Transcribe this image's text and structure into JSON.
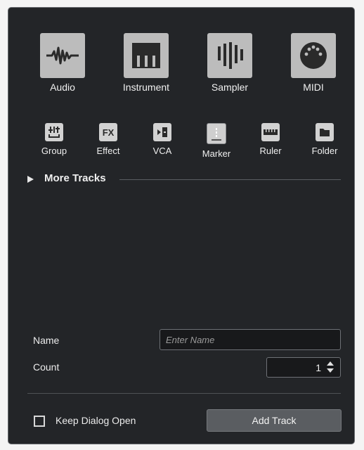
{
  "track_types": [
    {
      "label": "Audio",
      "icon": "audio-waveform-icon"
    },
    {
      "label": "Instrument",
      "icon": "piano-keys-icon"
    },
    {
      "label": "Sampler",
      "icon": "sampler-bars-icon"
    },
    {
      "label": "MIDI",
      "icon": "midi-connector-icon"
    }
  ],
  "small_types": [
    {
      "label": "Group",
      "icon": "group-icon"
    },
    {
      "label": "Effect",
      "icon": "fx-icon",
      "glyph": "FX"
    },
    {
      "label": "VCA",
      "icon": "vca-icon"
    },
    {
      "label": "Marker",
      "icon": "marker-icon"
    },
    {
      "label": "Ruler",
      "icon": "ruler-icon"
    },
    {
      "label": "Folder",
      "icon": "folder-icon"
    }
  ],
  "more_tracks": {
    "label": "More Tracks"
  },
  "form": {
    "name_label": "Name",
    "name_placeholder": "Enter Name",
    "count_label": "Count",
    "count_value": "1"
  },
  "footer": {
    "keep_open_label": "Keep Dialog Open",
    "keep_open_checked": false,
    "add_button_label": "Add Track"
  },
  "colors": {
    "dialog_bg": "#232528",
    "tile_bg": "#bcbcbc",
    "icon_dark": "#2a2a2a"
  }
}
